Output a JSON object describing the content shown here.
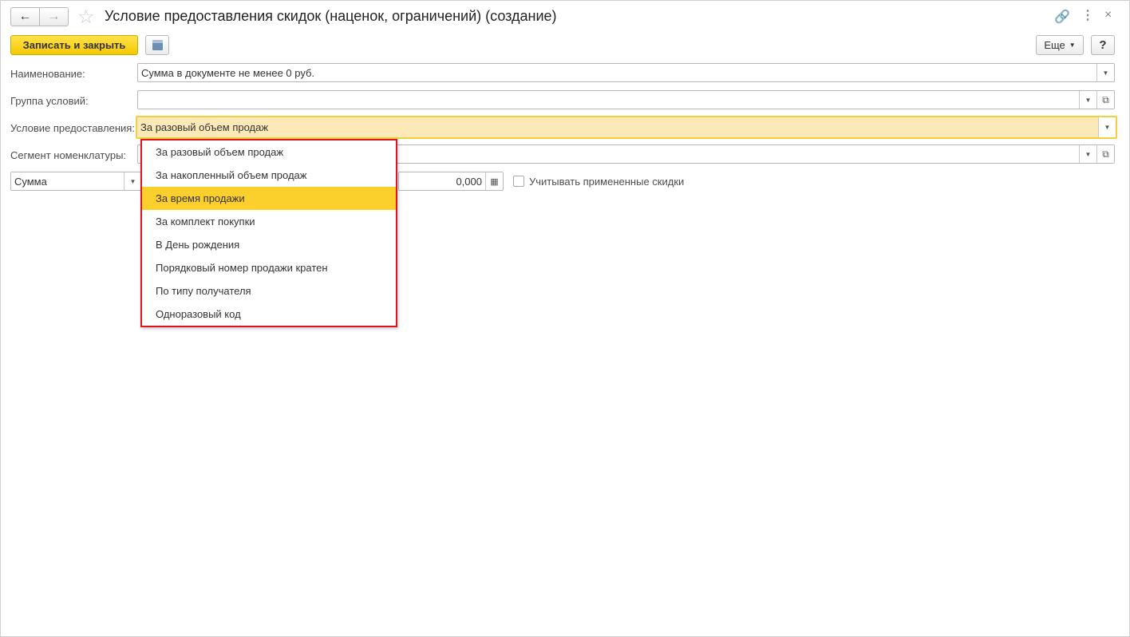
{
  "window": {
    "title": "Условие предоставления скидок (наценок, ограничений) (создание)"
  },
  "toolbar": {
    "save_close_label": "Записать и закрыть",
    "more_label": "Еще",
    "help_label": "?"
  },
  "form": {
    "name": {
      "label": "Наименование:",
      "value": "Сумма в документе не менее 0 руб."
    },
    "group": {
      "label": "Группа условий:",
      "value": ""
    },
    "condition": {
      "label": "Условие предоставления:",
      "value": "За разовый объем продаж"
    },
    "segment": {
      "label": "Сегмент номенклатуры:",
      "value": ""
    },
    "kind": {
      "value": "Сумма"
    },
    "amount": {
      "value": "0,000"
    },
    "consider_discounts": {
      "label": "Учитывать примененные скидки",
      "checked": false
    }
  },
  "dropdown": {
    "selected_index": 2,
    "items": [
      "За разовый объем продаж",
      "За накопленный объем продаж",
      "За время продажи",
      "За комплект покупки",
      "В День рождения",
      "Порядковый номер продажи кратен",
      "По типу получателя",
      "Одноразовый код"
    ]
  }
}
